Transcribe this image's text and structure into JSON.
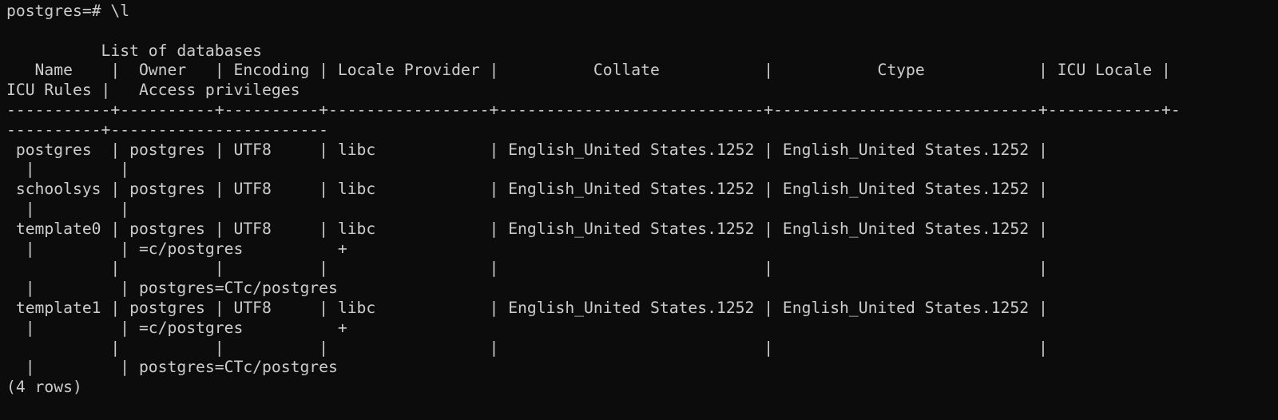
{
  "terminal": {
    "scrollback_fragment": "                             .",
    "lines": [
      "postgres=# \\l",
      "",
      "          List of databases",
      "   Name    |  Owner   | Encoding | Locale Provider |          Collate           |           Ctype            | ICU Locale |",
      "ICU Rules |   Access privileges",
      "-----------+----------+----------+-----------------+----------------------------+----------------------------+------------+-",
      "----------+-----------------------",
      " postgres  | postgres | UTF8     | libc            | English_United States.1252 | English_United States.1252 |",
      "  |         |",
      " schoolsys | postgres | UTF8     | libc            | English_United States.1252 | English_United States.1252 |",
      "  |         |",
      " template0 | postgres | UTF8     | libc            | English_United States.1252 | English_United States.1252 |",
      "  |         | =c/postgres          +",
      "           |          |          |                 |                            |                            |",
      "  |         | postgres=CTc/postgres",
      " template1 | postgres | UTF8     | libc            | English_United States.1252 | English_United States.1252 |",
      "  |         | =c/postgres          +",
      "           |          |          |                 |                            |                            |",
      "  |         | postgres=CTc/postgres",
      "(4 rows)"
    ]
  },
  "colors": {
    "background": "#0c0c0c",
    "foreground": "#cccccc"
  }
}
